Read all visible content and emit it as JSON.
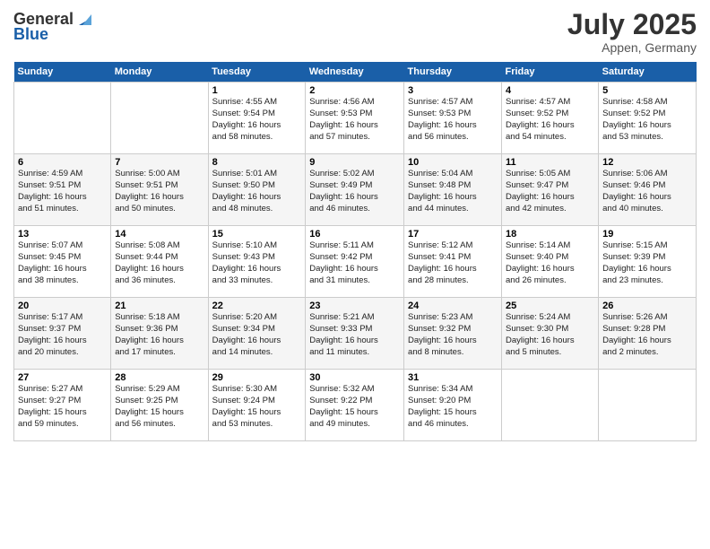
{
  "header": {
    "logo_line1": "General",
    "logo_line2": "Blue",
    "month_year": "July 2025",
    "location": "Appen, Germany"
  },
  "days_of_week": [
    "Sunday",
    "Monday",
    "Tuesday",
    "Wednesday",
    "Thursday",
    "Friday",
    "Saturday"
  ],
  "weeks": [
    [
      {
        "day": "",
        "info": ""
      },
      {
        "day": "",
        "info": ""
      },
      {
        "day": "1",
        "info": "Sunrise: 4:55 AM\nSunset: 9:54 PM\nDaylight: 16 hours\nand 58 minutes."
      },
      {
        "day": "2",
        "info": "Sunrise: 4:56 AM\nSunset: 9:53 PM\nDaylight: 16 hours\nand 57 minutes."
      },
      {
        "day": "3",
        "info": "Sunrise: 4:57 AM\nSunset: 9:53 PM\nDaylight: 16 hours\nand 56 minutes."
      },
      {
        "day": "4",
        "info": "Sunrise: 4:57 AM\nSunset: 9:52 PM\nDaylight: 16 hours\nand 54 minutes."
      },
      {
        "day": "5",
        "info": "Sunrise: 4:58 AM\nSunset: 9:52 PM\nDaylight: 16 hours\nand 53 minutes."
      }
    ],
    [
      {
        "day": "6",
        "info": "Sunrise: 4:59 AM\nSunset: 9:51 PM\nDaylight: 16 hours\nand 51 minutes."
      },
      {
        "day": "7",
        "info": "Sunrise: 5:00 AM\nSunset: 9:51 PM\nDaylight: 16 hours\nand 50 minutes."
      },
      {
        "day": "8",
        "info": "Sunrise: 5:01 AM\nSunset: 9:50 PM\nDaylight: 16 hours\nand 48 minutes."
      },
      {
        "day": "9",
        "info": "Sunrise: 5:02 AM\nSunset: 9:49 PM\nDaylight: 16 hours\nand 46 minutes."
      },
      {
        "day": "10",
        "info": "Sunrise: 5:04 AM\nSunset: 9:48 PM\nDaylight: 16 hours\nand 44 minutes."
      },
      {
        "day": "11",
        "info": "Sunrise: 5:05 AM\nSunset: 9:47 PM\nDaylight: 16 hours\nand 42 minutes."
      },
      {
        "day": "12",
        "info": "Sunrise: 5:06 AM\nSunset: 9:46 PM\nDaylight: 16 hours\nand 40 minutes."
      }
    ],
    [
      {
        "day": "13",
        "info": "Sunrise: 5:07 AM\nSunset: 9:45 PM\nDaylight: 16 hours\nand 38 minutes."
      },
      {
        "day": "14",
        "info": "Sunrise: 5:08 AM\nSunset: 9:44 PM\nDaylight: 16 hours\nand 36 minutes."
      },
      {
        "day": "15",
        "info": "Sunrise: 5:10 AM\nSunset: 9:43 PM\nDaylight: 16 hours\nand 33 minutes."
      },
      {
        "day": "16",
        "info": "Sunrise: 5:11 AM\nSunset: 9:42 PM\nDaylight: 16 hours\nand 31 minutes."
      },
      {
        "day": "17",
        "info": "Sunrise: 5:12 AM\nSunset: 9:41 PM\nDaylight: 16 hours\nand 28 minutes."
      },
      {
        "day": "18",
        "info": "Sunrise: 5:14 AM\nSunset: 9:40 PM\nDaylight: 16 hours\nand 26 minutes."
      },
      {
        "day": "19",
        "info": "Sunrise: 5:15 AM\nSunset: 9:39 PM\nDaylight: 16 hours\nand 23 minutes."
      }
    ],
    [
      {
        "day": "20",
        "info": "Sunrise: 5:17 AM\nSunset: 9:37 PM\nDaylight: 16 hours\nand 20 minutes."
      },
      {
        "day": "21",
        "info": "Sunrise: 5:18 AM\nSunset: 9:36 PM\nDaylight: 16 hours\nand 17 minutes."
      },
      {
        "day": "22",
        "info": "Sunrise: 5:20 AM\nSunset: 9:34 PM\nDaylight: 16 hours\nand 14 minutes."
      },
      {
        "day": "23",
        "info": "Sunrise: 5:21 AM\nSunset: 9:33 PM\nDaylight: 16 hours\nand 11 minutes."
      },
      {
        "day": "24",
        "info": "Sunrise: 5:23 AM\nSunset: 9:32 PM\nDaylight: 16 hours\nand 8 minutes."
      },
      {
        "day": "25",
        "info": "Sunrise: 5:24 AM\nSunset: 9:30 PM\nDaylight: 16 hours\nand 5 minutes."
      },
      {
        "day": "26",
        "info": "Sunrise: 5:26 AM\nSunset: 9:28 PM\nDaylight: 16 hours\nand 2 minutes."
      }
    ],
    [
      {
        "day": "27",
        "info": "Sunrise: 5:27 AM\nSunset: 9:27 PM\nDaylight: 15 hours\nand 59 minutes."
      },
      {
        "day": "28",
        "info": "Sunrise: 5:29 AM\nSunset: 9:25 PM\nDaylight: 15 hours\nand 56 minutes."
      },
      {
        "day": "29",
        "info": "Sunrise: 5:30 AM\nSunset: 9:24 PM\nDaylight: 15 hours\nand 53 minutes."
      },
      {
        "day": "30",
        "info": "Sunrise: 5:32 AM\nSunset: 9:22 PM\nDaylight: 15 hours\nand 49 minutes."
      },
      {
        "day": "31",
        "info": "Sunrise: 5:34 AM\nSunset: 9:20 PM\nDaylight: 15 hours\nand 46 minutes."
      },
      {
        "day": "",
        "info": ""
      },
      {
        "day": "",
        "info": ""
      }
    ]
  ]
}
